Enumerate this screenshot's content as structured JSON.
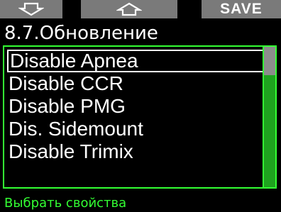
{
  "softkeys": {
    "left_icon": "down-arrow-icon",
    "middle_icon": "up-arrow-icon",
    "right_label": "SAVE"
  },
  "title": "8.7.Обновление",
  "menu": {
    "items": [
      {
        "label": "Disable Apnea",
        "selected": true
      },
      {
        "label": "Disable CCR",
        "selected": false
      },
      {
        "label": "Disable PMG",
        "selected": false
      },
      {
        "label": "Dis. Sidemount",
        "selected": false
      },
      {
        "label": "Disable Trimix",
        "selected": false
      }
    ],
    "scroll_position": 0
  },
  "hint": "Выбрать свойства",
  "colors": {
    "background": "#000000",
    "accent": "#33ff33",
    "softkey": "#7a7a7a",
    "scrollbar": "#1fa21f",
    "text": "#ffffff"
  }
}
